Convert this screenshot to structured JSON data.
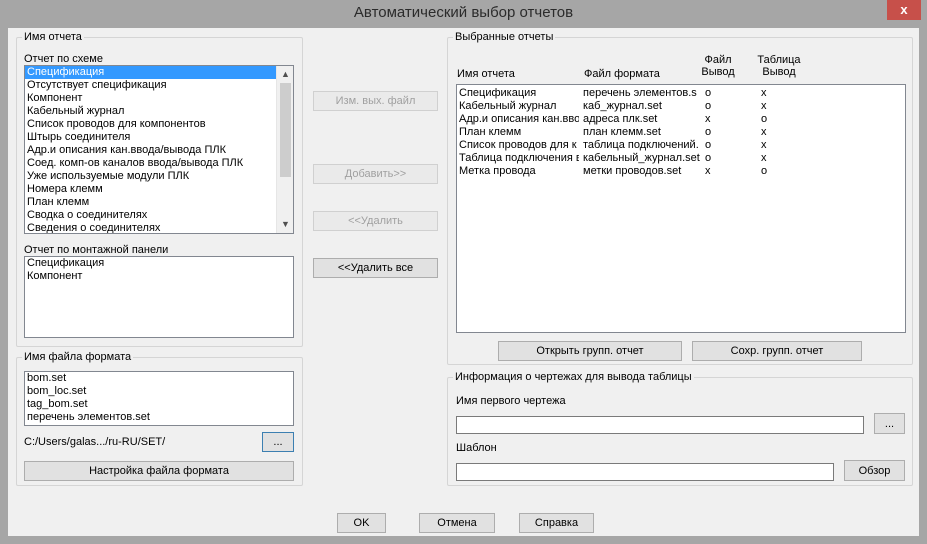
{
  "window": {
    "title": "Автоматический выбор отчетов",
    "close_label": "x"
  },
  "report_name": {
    "group_label": "Имя отчета",
    "by_scheme_label": "Отчет по схеме",
    "by_scheme_items": [
      "Спецификация",
      "Отсутствует спецификация",
      "Компонент",
      "Кабельный журнал",
      "Список проводов для компонентов",
      "Штырь соединителя",
      "Адр.и описания кан.ввода/вывода ПЛК",
      "Соед. комп-ов каналов ввода/вывода ПЛК",
      "Уже используемые модули ПЛК",
      "Номера клемм",
      "План клемм",
      "Сводка о соединителях",
      "Сведения о соединителях"
    ],
    "by_panel_label": "Отчет по монтажной панели",
    "by_panel_items": [
      "Спецификация",
      "Компонент"
    ]
  },
  "format_file": {
    "group_label": "Имя файла формата",
    "items": [
      "bom.set",
      "bom_loc.set",
      "tag_bom.set",
      "перечень элементов.set"
    ],
    "path": "C:/Users/galas.../ru-RU/SET/",
    "browse_label": "...",
    "settings_label": "Настройка файла формата"
  },
  "middle": {
    "change_label": "Изм. вых. файл",
    "add_label": "Добавить>>",
    "remove_label": "<<Удалить",
    "remove_all_label": "<<Удалить все"
  },
  "selected": {
    "group_label": "Выбранные отчеты",
    "col_name": "Имя отчета",
    "col_format": "Файл формата",
    "col_file_1": "Файл",
    "col_file_2": "Вывод",
    "col_table_1": "Таблица",
    "col_table_2": "Вывод",
    "rows": [
      {
        "name": "Спецификация",
        "format": "перечень элементов.s",
        "file": "o",
        "table": "x"
      },
      {
        "name": "Кабельный журнал",
        "format": "каб_журнал.set",
        "file": "o",
        "table": "x"
      },
      {
        "name": "Адр.и описания кан.вво",
        "format": "адреса плк.set",
        "file": "x",
        "table": "o"
      },
      {
        "name": "План клемм",
        "format": "план клемм.set",
        "file": "o",
        "table": "x"
      },
      {
        "name": "Список проводов для к",
        "format": "таблица подключений.",
        "file": "o",
        "table": "x"
      },
      {
        "name": "Таблица подключения в",
        "format": "кабельный_журнал.set",
        "file": "o",
        "table": "x"
      },
      {
        "name": "Метка провода",
        "format": "метки проводов.set",
        "file": "x",
        "table": "o"
      }
    ],
    "open_group_label": "Открыть групп. отчет",
    "save_group_label": "Сохр. групп. отчет"
  },
  "drawing_info": {
    "group_label": "Информация о чертежах для вывода таблицы",
    "first_drawing_label": "Имя первого чертежа",
    "first_drawing_value": "",
    "browse_label": "...",
    "template_label": "Шаблон",
    "template_value": "",
    "review_label": "Обзор"
  },
  "footer": {
    "ok_label": "OK",
    "cancel_label": "Отмена",
    "help_label": "Справка"
  }
}
